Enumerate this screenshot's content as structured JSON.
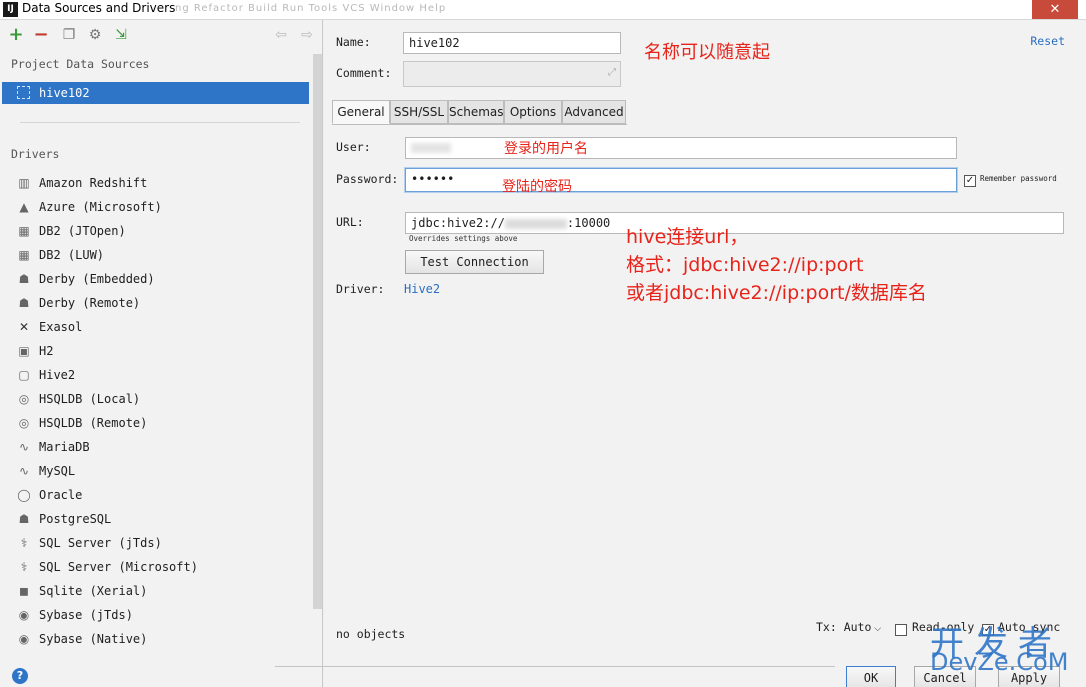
{
  "window": {
    "title": "Data Sources and Drivers",
    "app_icon": "IJ",
    "ghost_menu": "ng  Refactor  Build  Run  Tools  VCS  Window  Help",
    "close_glyph": "✕"
  },
  "toolbar": {
    "add": "+",
    "remove": "−",
    "duplicate": "❐",
    "settings": "⚙",
    "import": "⇲",
    "back": "⇦",
    "forward": "⇨"
  },
  "sidebar": {
    "project_title": "Project Data Sources",
    "selected_source": "hive102",
    "drivers_title": "Drivers",
    "drivers": [
      {
        "label": "Amazon Redshift",
        "icon": "▥"
      },
      {
        "label": "Azure (Microsoft)",
        "icon": "▲"
      },
      {
        "label": "DB2 (JTOpen)",
        "icon": "▦"
      },
      {
        "label": "DB2 (LUW)",
        "icon": "▦"
      },
      {
        "label": "Derby (Embedded)",
        "icon": "☗"
      },
      {
        "label": "Derby (Remote)",
        "icon": "☗"
      },
      {
        "label": "Exasol",
        "icon": "✕"
      },
      {
        "label": "H2",
        "icon": "▣"
      },
      {
        "label": "Hive2",
        "icon": "▢"
      },
      {
        "label": "HSQLDB (Local)",
        "icon": "◎"
      },
      {
        "label": "HSQLDB (Remote)",
        "icon": "◎"
      },
      {
        "label": "MariaDB",
        "icon": "∿"
      },
      {
        "label": "MySQL",
        "icon": "∿"
      },
      {
        "label": "Oracle",
        "icon": "◯"
      },
      {
        "label": "PostgreSQL",
        "icon": "☗"
      },
      {
        "label": "SQL Server (jTds)",
        "icon": "⚕"
      },
      {
        "label": "SQL Server (Microsoft)",
        "icon": "⚕"
      },
      {
        "label": "Sqlite (Xerial)",
        "icon": "◼"
      },
      {
        "label": "Sybase (jTds)",
        "icon": "◉"
      },
      {
        "label": "Sybase (Native)",
        "icon": "◉"
      }
    ],
    "help": "?"
  },
  "form": {
    "name_label": "Name:",
    "name_value": "hive102",
    "comment_label": "Comment:",
    "reset": "Reset",
    "tabs": [
      "General",
      "SSH/SSL",
      "Schemas",
      "Options",
      "Advanced"
    ],
    "user_label": "User:",
    "password_label": "Password:",
    "password_value": "••••••",
    "remember_password": "Remember password",
    "url_label": "URL:",
    "url_value_prefix": "jdbc:hive2://",
    "url_value_suffix": ":10000",
    "overrides_hint": "Overrides settings above",
    "test_connection": "Test Connection",
    "driver_label": "Driver:",
    "driver_value": "Hive2",
    "status": "no objects",
    "tx_label": "Tx: Auto",
    "read_only": "Read-only",
    "auto_sync": "Auto sync",
    "ok": "OK",
    "cancel": "Cancel",
    "apply": "Apply"
  },
  "annotations": {
    "name_note": "名称可以随意起",
    "user_note": "登录的用户名",
    "password_note": "登陆的密码",
    "url_note_1": "hive连接url，",
    "url_note_2": "格式：jdbc:hive2://ip:port",
    "url_note_3": "或者jdbc:hive2://ip:port/数据库名"
  },
  "watermark": {
    "line1": "开发者",
    "line2": "DevZe.CoM"
  },
  "colors": {
    "selection": "#2f75c7",
    "annotation": "#e8231a",
    "link": "#2a6fc0"
  }
}
